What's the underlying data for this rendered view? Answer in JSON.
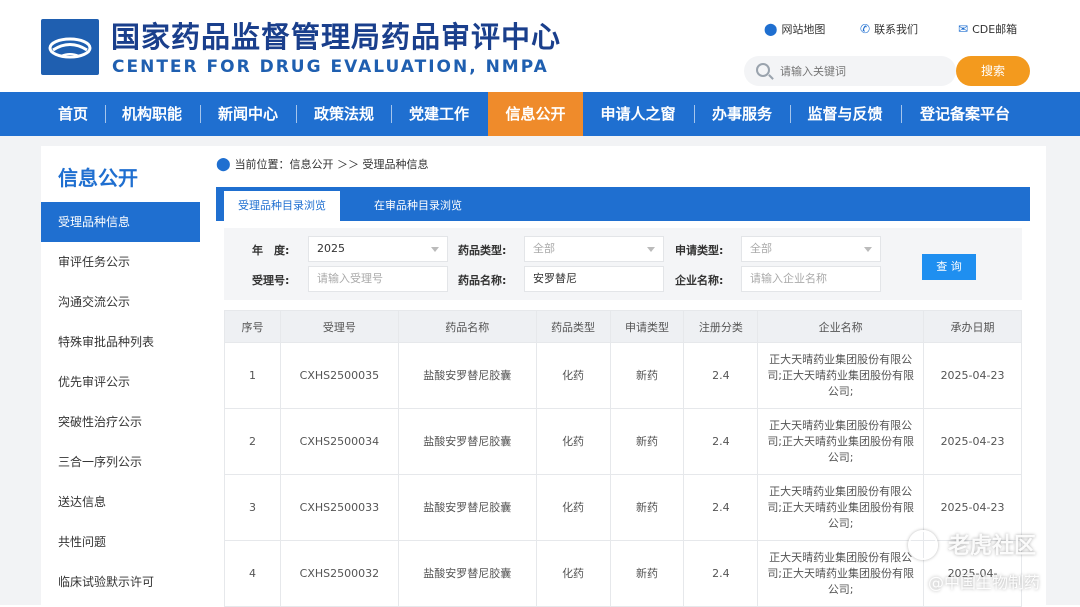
{
  "header": {
    "title_cn": "国家药品监督管理局药品审评中心",
    "title_en": "CENTER FOR DRUG EVALUATION, NMPA",
    "links": [
      {
        "label": "网站地图",
        "icon": "map-pin-icon"
      },
      {
        "label": "联系我们",
        "icon": "phone-icon"
      },
      {
        "label": "CDE邮箱",
        "icon": "mail-icon"
      }
    ],
    "search_placeholder": "请输入关键词",
    "search_button": "搜索"
  },
  "nav": {
    "items": [
      "首页",
      "机构职能",
      "新闻中心",
      "政策法规",
      "党建工作",
      "信息公开",
      "申请人之窗",
      "办事服务",
      "监督与反馈",
      "登记备案平台"
    ],
    "active": "信息公开"
  },
  "sidebar": {
    "title": "信息公开",
    "items": [
      "受理品种信息",
      "审评任务公示",
      "沟通交流公示",
      "特殊审批品种列表",
      "优先审评公示",
      "突破性治疗公示",
      "三合一序列公示",
      "送达信息",
      "共性问题",
      "临床试验默示许可"
    ],
    "active": "受理品种信息"
  },
  "breadcrumb": {
    "text": "当前位置：信息公开 ＞＞ 受理品种信息"
  },
  "tabs": [
    "受理品种目录浏览",
    "在审品种目录浏览"
  ],
  "filters": {
    "year_label": "年　度:",
    "year_value": "2025",
    "drug_type_label": "药品类型:",
    "drug_type_value": "全部",
    "apply_type_label": "申请类型:",
    "apply_type_value": "全部",
    "accept_no_label": "受理号:",
    "accept_no_placeholder": "请输入受理号",
    "drug_name_label": "药品名称:",
    "drug_name_value": "安罗替尼",
    "company_label": "企业名称:",
    "company_placeholder": "请输入企业名称",
    "query_button": "查 询"
  },
  "table": {
    "headers": [
      "序号",
      "受理号",
      "药品名称",
      "药品类型",
      "申请类型",
      "注册分类",
      "企业名称",
      "承办日期"
    ],
    "rows": [
      [
        "1",
        "CXHS2500035",
        "盐酸安罗替尼胶囊",
        "化药",
        "新药",
        "2.4",
        "正大天晴药业集团股份有限公司;正大天晴药业集团股份有限公司;",
        "2025-04-23"
      ],
      [
        "2",
        "CXHS2500034",
        "盐酸安罗替尼胶囊",
        "化药",
        "新药",
        "2.4",
        "正大天晴药业集团股份有限公司;正大天晴药业集团股份有限公司;",
        "2025-04-23"
      ],
      [
        "3",
        "CXHS2500033",
        "盐酸安罗替尼胶囊",
        "化药",
        "新药",
        "2.4",
        "正大天晴药业集团股份有限公司;正大天晴药业集团股份有限公司;",
        "2025-04-23"
      ],
      [
        "4",
        "CXHS2500032",
        "盐酸安罗替尼胶囊",
        "化药",
        "新药",
        "2.4",
        "正大天晴药业集团股份有限公司;正大天晴药业集团股份有限公司;",
        "2025-04-"
      ]
    ]
  },
  "watermark": {
    "line1": "老虎社区",
    "line2": "@中国生物制药"
  },
  "colors": {
    "primary": "#1f6fd0",
    "accent": "#ef8b2b",
    "search_button": "#f39a1e"
  }
}
